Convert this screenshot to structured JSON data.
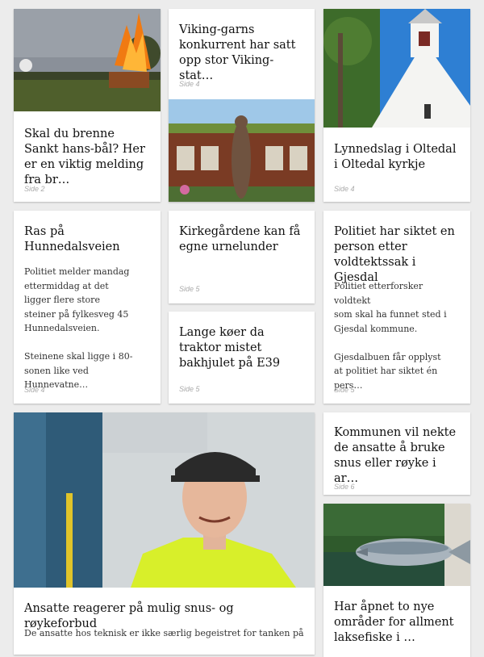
{
  "articles": [
    {
      "title": "Skal du brenne Sankt hans-bål? Her er en viktig melding fra br…",
      "page": "Side 2"
    },
    {
      "title": "Viking-garns konkurrent har satt opp stor Viking-stat…",
      "page": "Side 4"
    },
    {
      "title": "Lynnedslag i Oltedal i Oltedal kyrkje",
      "page": "Side 4"
    },
    {
      "title": "Ras på Hunnedalsveien",
      "excerpt": "Politiet melder mandag\nettermiddag at det\nligger flere store\nsteiner på fylkesveg 45\nHunnedalsveien.\n\nSteinene skal ligge i 80-\nsonen like ved Hunnevatne…",
      "page": "Side 4"
    },
    {
      "title": "Kirkegårdene kan få egne urnelunder",
      "page": "Side 5"
    },
    {
      "title": "Lange køer da traktor mistet bakhjulet på E39",
      "page": "Side 5"
    },
    {
      "title": "Politiet har siktet en person etter voldtektssak i Gjesdal",
      "excerpt": "Politiet etterforsker voldtekt\nsom skal ha funnet sted i\nGjesdal kommune.\n\nGjesdalbuen får opplyst\nat politiet har siktet én pers…",
      "page": "Side 5"
    },
    {
      "title": "Ansatte reagerer på mulig snus- og røykeforbud",
      "excerpt": "De ansatte hos teknisk er ikke særlig begeistret for tanken på e…"
    },
    {
      "title": "Kommunen vil nekte de ansatte å bruke snus eller røyke i ar…",
      "page": "Side 6"
    },
    {
      "title": "Har åpnet to nye områder for allment laksefiske i …"
    }
  ],
  "colors": {
    "background": "#ececec",
    "card": "#ffffff",
    "title": "#111111",
    "excerpt": "#333333",
    "page_label": "#aaaaaa"
  }
}
